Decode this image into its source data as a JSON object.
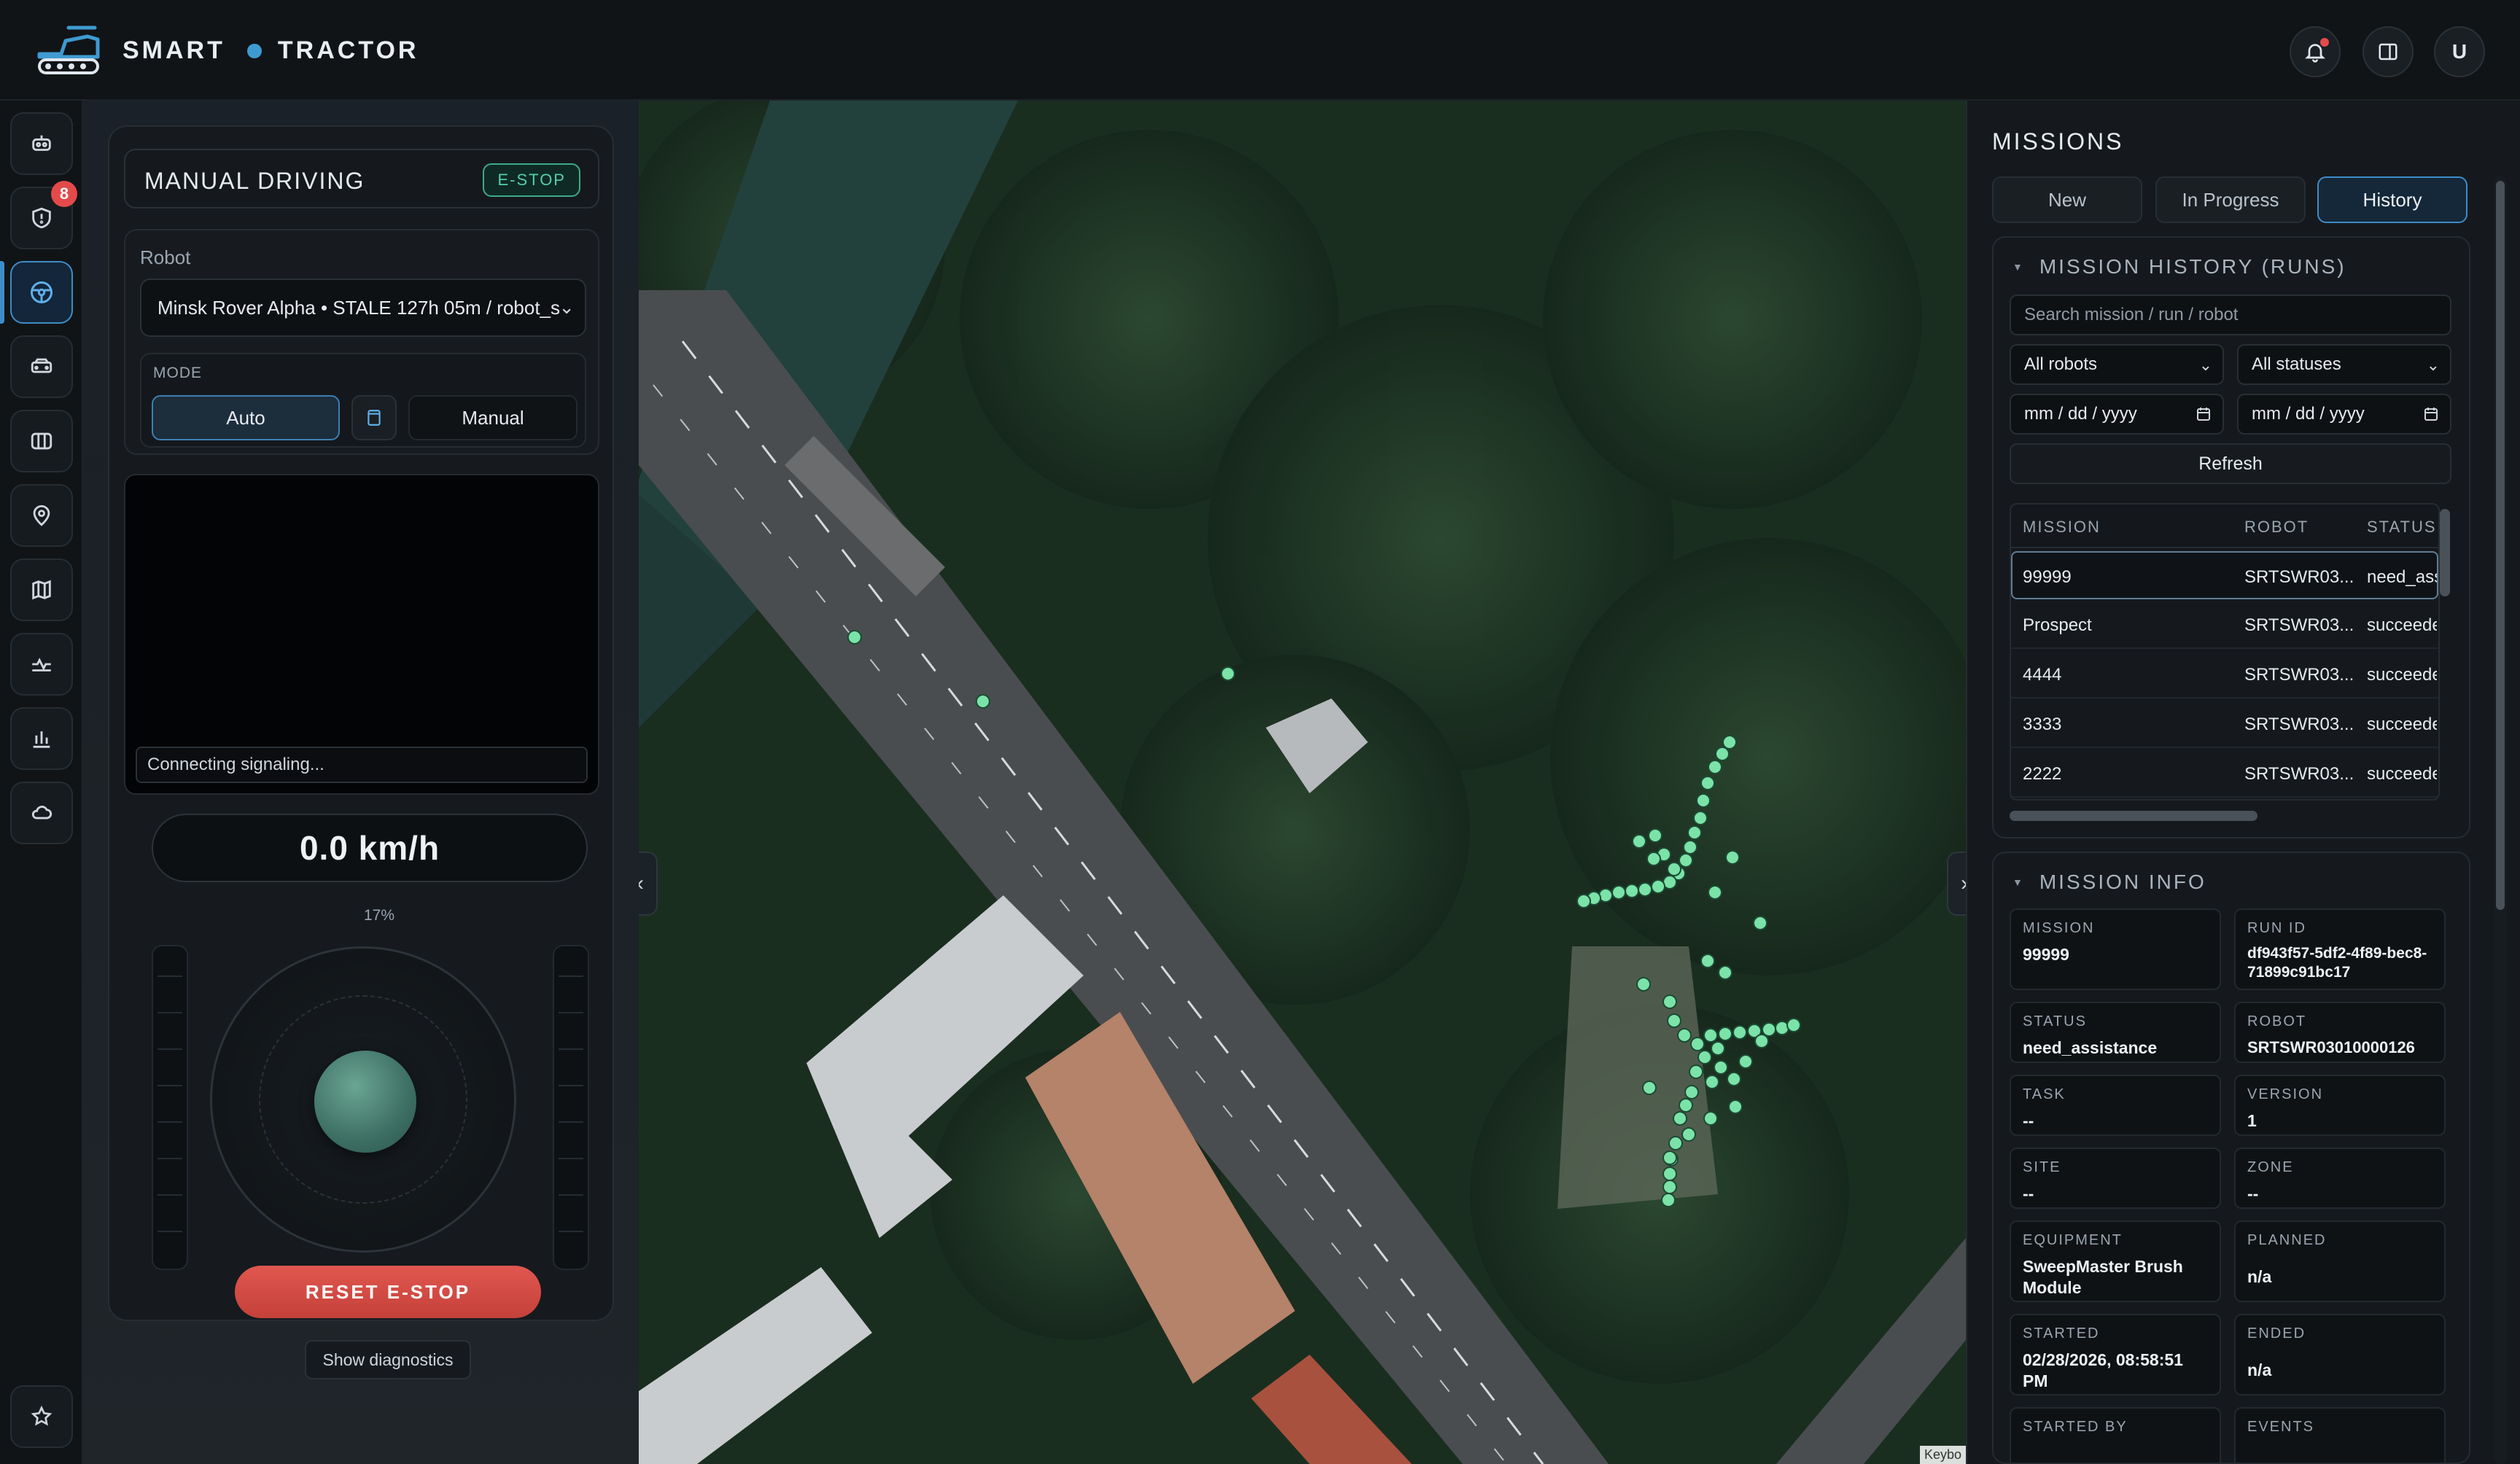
{
  "header": {
    "brand_left": "SMART",
    "brand_right": "TRACTOR",
    "buttons": [
      {
        "icon": "bell-icon"
      },
      {
        "icon": "panel-toggle-icon"
      },
      {
        "icon": "user-avatar",
        "label": "U"
      }
    ]
  },
  "rail": {
    "items": [
      {
        "icon": "robot-icon"
      },
      {
        "icon": "shield-icon",
        "badge": "8"
      },
      {
        "icon": "steering-wheel-icon",
        "active": true
      },
      {
        "icon": "vehicle-icon"
      },
      {
        "icon": "map-icon"
      },
      {
        "icon": "location-pin-icon"
      },
      {
        "icon": "route-map-icon"
      },
      {
        "icon": "activity-icon"
      },
      {
        "icon": "bar-chart-icon"
      },
      {
        "icon": "cloud-icon"
      }
    ],
    "bottom_icon": "star-settings-icon"
  },
  "drive": {
    "title": "MANUAL DRIVING",
    "estop_badge": "E-STOP",
    "robot_label": "Robot",
    "robot_value": "Minsk Rover Alpha • STALE 127h 05m / robot_s",
    "mode_label": "MODE",
    "mode_auto": "Auto",
    "mode_manual": "Manual",
    "video_status": "Connecting signaling...",
    "speed": "0.0 km/h",
    "throttle_percent": "17%",
    "reset_button": "RESET E-STOP",
    "diagnostics_button": "Show diagnostics"
  },
  "map": {
    "attribution": "Keybo",
    "accent_color": "#7be3a8"
  },
  "missions": {
    "title": "MISSIONS",
    "tabs": [
      {
        "label": "New"
      },
      {
        "label": "In Progress"
      },
      {
        "label": "History",
        "active": true
      }
    ],
    "history": {
      "title": "MISSION HISTORY (RUNS)",
      "search_placeholder": "Search mission / run / robot",
      "robots_filter": "All robots",
      "status_filter": "All statuses",
      "date_from": "mm / dd / yyyy",
      "date_to": "mm / dd / yyyy",
      "refresh": "Refresh",
      "columns": [
        "MISSION",
        "ROBOT",
        "STATUS"
      ],
      "rows": [
        {
          "mission": "99999",
          "robot": "SRTSWR03...",
          "status": "need_assistance",
          "selected": true
        },
        {
          "mission": "Prospect",
          "robot": "SRTSWR03...",
          "status": "succeeded"
        },
        {
          "mission": "4444",
          "robot": "SRTSWR03...",
          "status": "succeeded"
        },
        {
          "mission": "3333",
          "robot": "SRTSWR03...",
          "status": "succeeded"
        },
        {
          "mission": "2222",
          "robot": "SRTSWR03...",
          "status": "succeeded"
        }
      ]
    },
    "info": {
      "title": "MISSION INFO",
      "fields": [
        {
          "key": "MISSION",
          "value": "99999"
        },
        {
          "key": "RUN ID",
          "value": "df943f57-5df2-4f89-bec8-71899c91bc17"
        },
        {
          "key": "STATUS",
          "value": "need_assistance"
        },
        {
          "key": "ROBOT",
          "value": "SRTSWR03010000126"
        },
        {
          "key": "TASK",
          "value": "--"
        },
        {
          "key": "VERSION",
          "value": "1"
        },
        {
          "key": "SITE",
          "value": "--"
        },
        {
          "key": "ZONE",
          "value": "--"
        },
        {
          "key": "EQUIPMENT",
          "value": "SweepMaster Brush Module"
        },
        {
          "key": "PLANNED",
          "value": "n/a"
        },
        {
          "key": "STARTED",
          "value": "02/28/2026, 08:58:51 PM"
        },
        {
          "key": "ENDED",
          "value": "n/a"
        },
        {
          "key": "STARTED BY",
          "value": ""
        },
        {
          "key": "EVENTS",
          "value": ""
        }
      ]
    }
  }
}
